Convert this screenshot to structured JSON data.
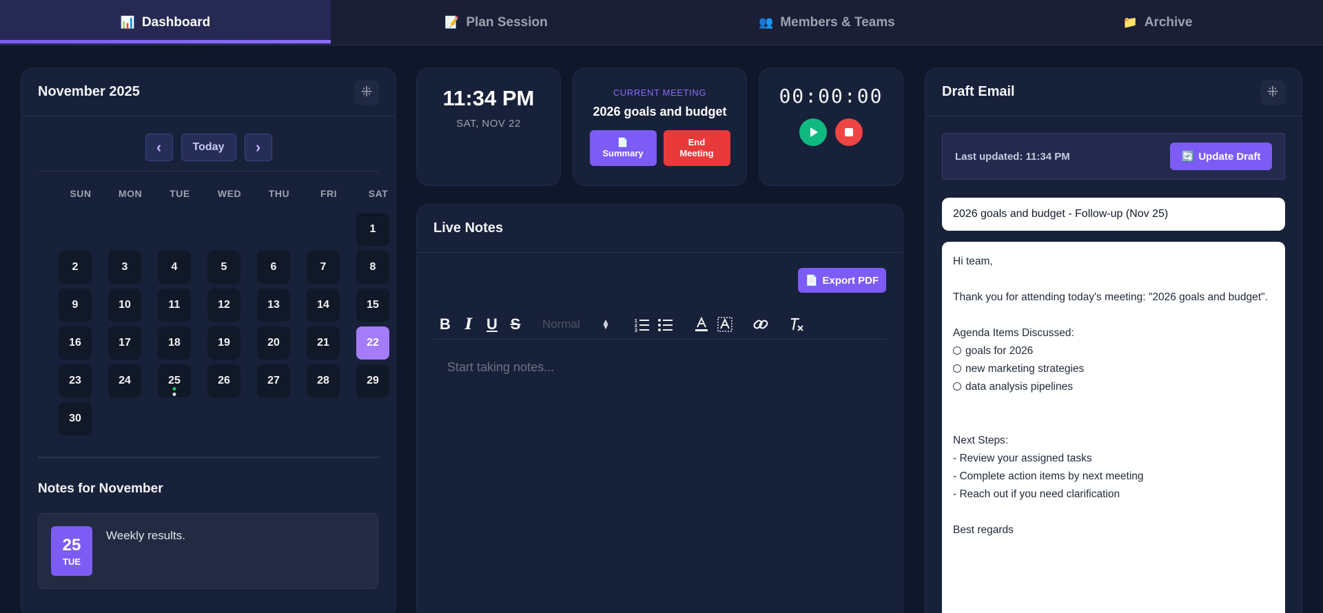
{
  "nav": {
    "tabs": [
      {
        "icon": "📊",
        "label": "Dashboard"
      },
      {
        "icon": "📝",
        "label": "Plan Session"
      },
      {
        "icon": "👥",
        "label": "Members & Teams"
      },
      {
        "icon": "📁",
        "label": "Archive"
      }
    ],
    "active_index": 0
  },
  "calendar": {
    "title": "November 2025",
    "collapse_icon": "⁜",
    "today_label": "Today",
    "prev_label": "‹",
    "next_label": "›",
    "weekdays": [
      "SUN",
      "MON",
      "TUE",
      "WED",
      "THU",
      "FRI",
      "SAT"
    ],
    "leading_blanks": 6,
    "days": [
      "1",
      "2",
      "3",
      "4",
      "5",
      "6",
      "7",
      "8",
      "9",
      "10",
      "11",
      "12",
      "13",
      "14",
      "15",
      "16",
      "17",
      "18",
      "19",
      "20",
      "21",
      "22",
      "23",
      "24",
      "25",
      "26",
      "27",
      "28",
      "29",
      "30"
    ],
    "selected_day": "22",
    "event_day": "25",
    "event_dot_colors": [
      "#22c55e",
      "#e5e7eb"
    ]
  },
  "month_notes": {
    "title": "Notes for November",
    "items": [
      {
        "day": "25",
        "weekday": "TUE",
        "text": "Weekly results."
      }
    ]
  },
  "clock": {
    "time": "11:34 PM",
    "date": "SAT, NOV 22"
  },
  "meeting": {
    "label": "CURRENT MEETING",
    "name": "2026 goals and budget",
    "summary_icon": "📄",
    "summary_label": "Summary",
    "end_label": "End Meeting"
  },
  "timer": {
    "value": "00:00:00"
  },
  "live_notes": {
    "title": "Live Notes",
    "export_icon": "📄",
    "export_label": "Export PDF",
    "format_select": "Normal",
    "placeholder": "Start taking notes..."
  },
  "draft_email": {
    "title": "Draft Email",
    "collapse_icon": "⁜",
    "last_updated": "Last updated: 11:34 PM",
    "update_icon": "🔄",
    "update_label": "Update Draft",
    "subject": "2026 goals and budget - Follow-up (Nov 25)",
    "greeting": "Hi team,",
    "intro": "Thank you for attending today's meeting: \"2026 goals and budget\".",
    "agenda_title": "Agenda Items Discussed:",
    "agenda_items": [
      "goals for 2026",
      "new marketing strategies",
      "data analysis pipelines"
    ],
    "next_steps_title": "Next Steps:",
    "next_steps": [
      "- Review your assigned tasks",
      "- Complete action items by next meeting",
      "- Reach out if you need clarification"
    ],
    "signoff": "Best regards"
  },
  "colors": {
    "accent": "#7c5cf5",
    "danger": "#e83a3a",
    "success": "#10b981",
    "background": "#0f172a",
    "panel": "#18213a"
  }
}
